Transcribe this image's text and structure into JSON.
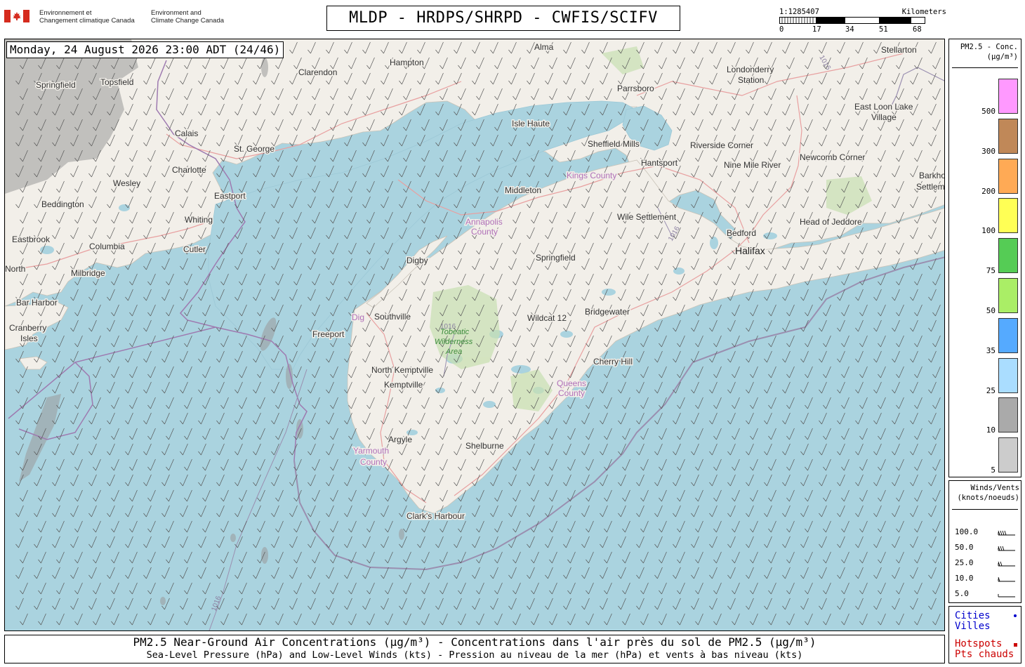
{
  "header": {
    "government_fr": [
      "Environnement et",
      "Changement climatique Canada"
    ],
    "government_en": [
      "Environment and",
      "Climate Change Canada"
    ],
    "title": "MLDP - HRDPS/SHRPD - CWFIS/SCIFV",
    "scale": {
      "ratio": "1:1285407",
      "unit_label": "Kilometers",
      "ticks": [
        "0",
        "17",
        "34",
        "51",
        "68"
      ]
    }
  },
  "map": {
    "timestamp": "Monday, 24 August 2026 23:00 ADT (24/46)",
    "colors": {
      "water": "#aad3df",
      "land": "#f2efe9",
      "isobar": "#9a8fb0",
      "border": "#9e7ab0",
      "smoke": "#a0a0a0"
    },
    "places": [
      "Alma",
      "Stellarton",
      "Clarendon",
      "Hampton",
      "Londonderry",
      "Station",
      "Springfield",
      "Topsfield",
      "Parrsboro",
      "East Loon Lake",
      "Village",
      "Isle Haute",
      "Calais",
      "St. George",
      "Sheffield Mills",
      "Riverside Corner",
      "Newcomb Corner",
      "Charlotte",
      "Hantsport",
      "Nine Mile River",
      "Wesley",
      "Eastport",
      "Middleton",
      "Barkho",
      "Settlem",
      "Beddington",
      "Whiting",
      "Wile Settlement",
      "Head of Jeddore",
      "Eastbrook",
      "Bedford",
      "Columbia",
      "Cutler",
      "Halifax",
      "Digby",
      "Springfield",
      "North",
      "Milbridge",
      "Bar Harbor",
      "Southville",
      "Bridgewater",
      "Cranberry",
      "Isles",
      "Wildcat 12",
      "Freeport",
      "Cherry Hill",
      "North Kemptville",
      "Kemptville",
      "Argyle",
      "Shelburne",
      "Clark's Harbour",
      "Dig"
    ],
    "counties": [
      "Kings County",
      "Annapolis",
      "County",
      "Queens",
      "County",
      "Yarmouth",
      "County"
    ],
    "park": [
      "Tobeatic",
      "Wilderness",
      "Area"
    ],
    "isobar_labels": [
      "1016",
      "1016",
      "1016",
      "1016"
    ]
  },
  "pm_legend": {
    "title": [
      "PM2.5 - Conc.",
      "(µg/m³)"
    ],
    "levels": [
      {
        "label": "500",
        "color": "#ff99ff"
      },
      {
        "label": "300",
        "color": "#c08858"
      },
      {
        "label": "200",
        "color": "#ffaa55"
      },
      {
        "label": "100",
        "color": "#ffff55"
      },
      {
        "label": "75",
        "color": "#55cc55"
      },
      {
        "label": "50",
        "color": "#aaee66"
      },
      {
        "label": "35",
        "color": "#55aaff"
      },
      {
        "label": "25",
        "color": "#aaddff"
      },
      {
        "label": "10",
        "color": "#aaaaaa"
      },
      {
        "label": "5",
        "color": "#cccccc"
      }
    ]
  },
  "wind_legend": {
    "title": [
      "Winds/Vents",
      "(knots/noeuds)"
    ],
    "speeds": [
      "100.0",
      "50.0",
      "25.0",
      "10.0",
      "5.0"
    ]
  },
  "point_legend": {
    "cities": [
      "Cities",
      "Villes"
    ],
    "cities_color": "#0000cc",
    "hotspots": [
      "Hotspots",
      "Pts chauds"
    ],
    "hotspots_color": "#cc0000"
  },
  "caption": {
    "line1": "PM2.5 Near-Ground Air Concentrations (µg/m³) - Concentrations dans l'air près du sol de PM2.5 (µg/m³)",
    "line2": "Sea-Level Pressure (hPa) and Low-Level Winds (kts) - Pression au niveau de la mer (hPa) et vents à bas niveau (kts)"
  }
}
